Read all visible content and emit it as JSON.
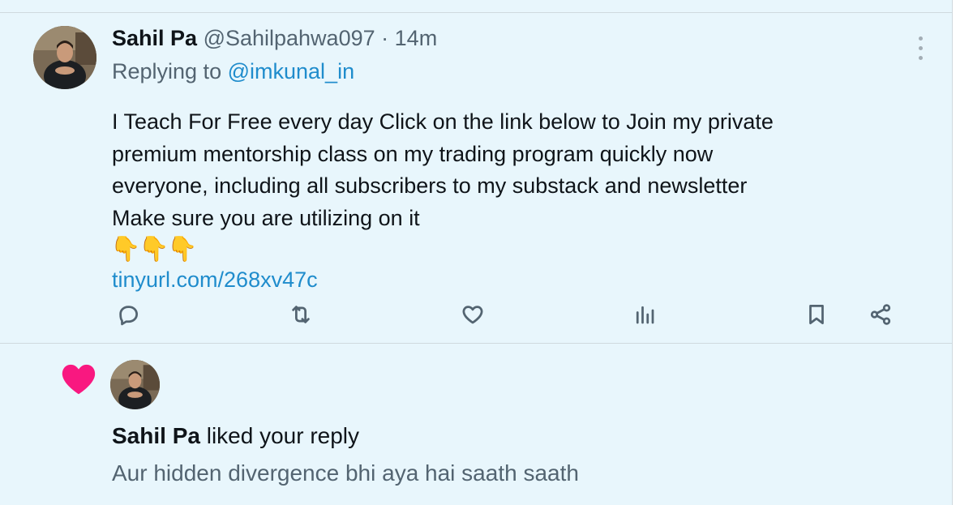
{
  "tweet": {
    "author_name": "Sahil Pa",
    "handle": "@Sahilpahwa097",
    "separator": "·",
    "time": "14m",
    "replying_prefix": "Replying to",
    "replying_to": "@imkunal_in",
    "text_lines": [
      "I Teach For Free every day Click on the link below to Join my private",
      "premium mentorship class on my trading program quickly now",
      "everyone, including all subscribers to my substack and newsletter",
      "Make sure you are utilizing on it"
    ],
    "emojis": [
      "👇",
      "👇",
      "👇"
    ],
    "link": "tinyurl.com/268xv47c",
    "actions": [
      "reply",
      "retweet",
      "like",
      "views",
      "bookmark",
      "share"
    ]
  },
  "notification": {
    "name": "Sahil Pa",
    "action_text": "liked your reply",
    "quoted_reply": "Aur hidden divergence bhi aya hai saath saath",
    "heart_color": "#f91880"
  },
  "colors": {
    "background": "#e8f6fc",
    "link": "#1f8ccc",
    "muted": "#536471",
    "divider": "#cfd9de"
  }
}
